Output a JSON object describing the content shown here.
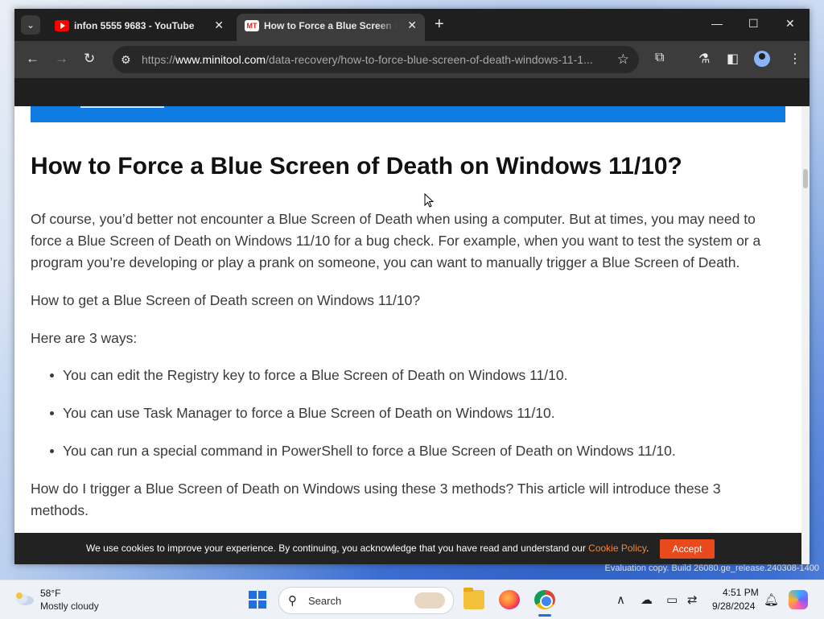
{
  "browser": {
    "tabs": [
      {
        "title": "infon 5555 9683 - YouTube",
        "icon": "youtube-icon",
        "active": false
      },
      {
        "title": "How to Force a Blue Screen of Death",
        "icon": "minitool-icon",
        "active": true
      }
    ],
    "minitool_favicon_text": "MT",
    "url_prefix": "https://",
    "url_host": "www.minitool.com",
    "url_path": "/data-recovery/how-to-force-blue-screen-of-death-windows-11-1..."
  },
  "article": {
    "heading": "How to Force a Blue Screen of Death on Windows 11/10?",
    "para1": "Of course, you’d better not encounter a Blue Screen of Death when using a computer. But at times, you may need to force a Blue Screen of Death on Windows 11/10 for a bug check. For example, when you want to test the system or a program you’re developing or play a prank on someone, you can want to manually trigger a Blue Screen of Death.",
    "para2": "How to get a Blue Screen of Death screen on Windows 11/10?",
    "para3": "Here are 3 ways:",
    "bullets": [
      "You can edit the Registry key to force a Blue Screen of Death on Windows 11/10.",
      "You can use Task Manager to force a Blue Screen of Death on Windows 11/10.",
      "You can run a special command in PowerShell to force a Blue Screen of Death on Windows 11/10."
    ],
    "para4": "How do I trigger a Blue Screen of Death on Windows using these 3 methods? This article will introduce these 3 methods."
  },
  "cookie": {
    "text": "We use cookies to improve your experience. By continuing, you acknowledge that you have read and understand our ",
    "link": "Cookie Policy",
    "suffix": ".",
    "accept": "Accept"
  },
  "desktop": {
    "watermark": "Evaluation copy. Build 26080.ge_release.240308-1400"
  },
  "taskbar": {
    "temperature": "58°F",
    "weather": "Mostly cloudy",
    "search_placeholder": "Search",
    "time": "4:51 PM",
    "date": "9/28/2024"
  },
  "colors": {
    "accent_blue": "#0e7ce0",
    "cookie_link": "#f0883e",
    "accept_button": "#e8491d",
    "tab_bar": "#1f1f1f",
    "toolbar": "#3c3c3c"
  }
}
